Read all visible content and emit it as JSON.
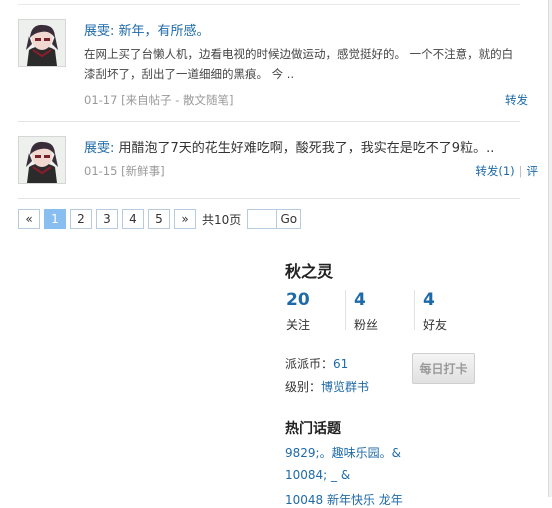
{
  "feed": {
    "items": [
      {
        "author": "展雯",
        "title": "新年，有所感。",
        "body": "在网上买了台懒人机，边看电视的时候边做运动，感觉挺好的。 一个不注意，就的白漆刮坏了，刮出了一道细细的黑痕。 今 ..",
        "date": "01-17",
        "source": "[来自帖子 - 散文随笔]",
        "actions": [
          "转发"
        ]
      },
      {
        "author": "展雯",
        "title": "用醋泡了7天的花生好难吃啊，酸死我了，我实在是吃不了9粒。..",
        "date": "01-15",
        "source": "[新鲜事]",
        "actions": [
          "转发(1)",
          "评"
        ]
      }
    ]
  },
  "pager": {
    "prev": "«",
    "pages": [
      "1",
      "2",
      "3",
      "4",
      "5"
    ],
    "active": "1",
    "next": "»",
    "total": "共10页",
    "go": "Go"
  },
  "profile": {
    "name": "秋之灵",
    "stats": [
      {
        "num": "20",
        "label": "关注"
      },
      {
        "num": "4",
        "label": "粉丝"
      },
      {
        "num": "4",
        "label": "好友"
      }
    ],
    "coins_label": "派派币：",
    "coins_value": "61",
    "level_label": "级别：",
    "level_value": "博览群书",
    "checkin_label": "每日打卡"
  },
  "topics": {
    "title": "热门话题",
    "items": [
      "9829;。趣味乐园。&",
      "10084; _ &",
      "10048 新年快乐 龙年"
    ]
  },
  "colors": {
    "link": "#1e6aa8",
    "pager_active": "#89bff0"
  }
}
